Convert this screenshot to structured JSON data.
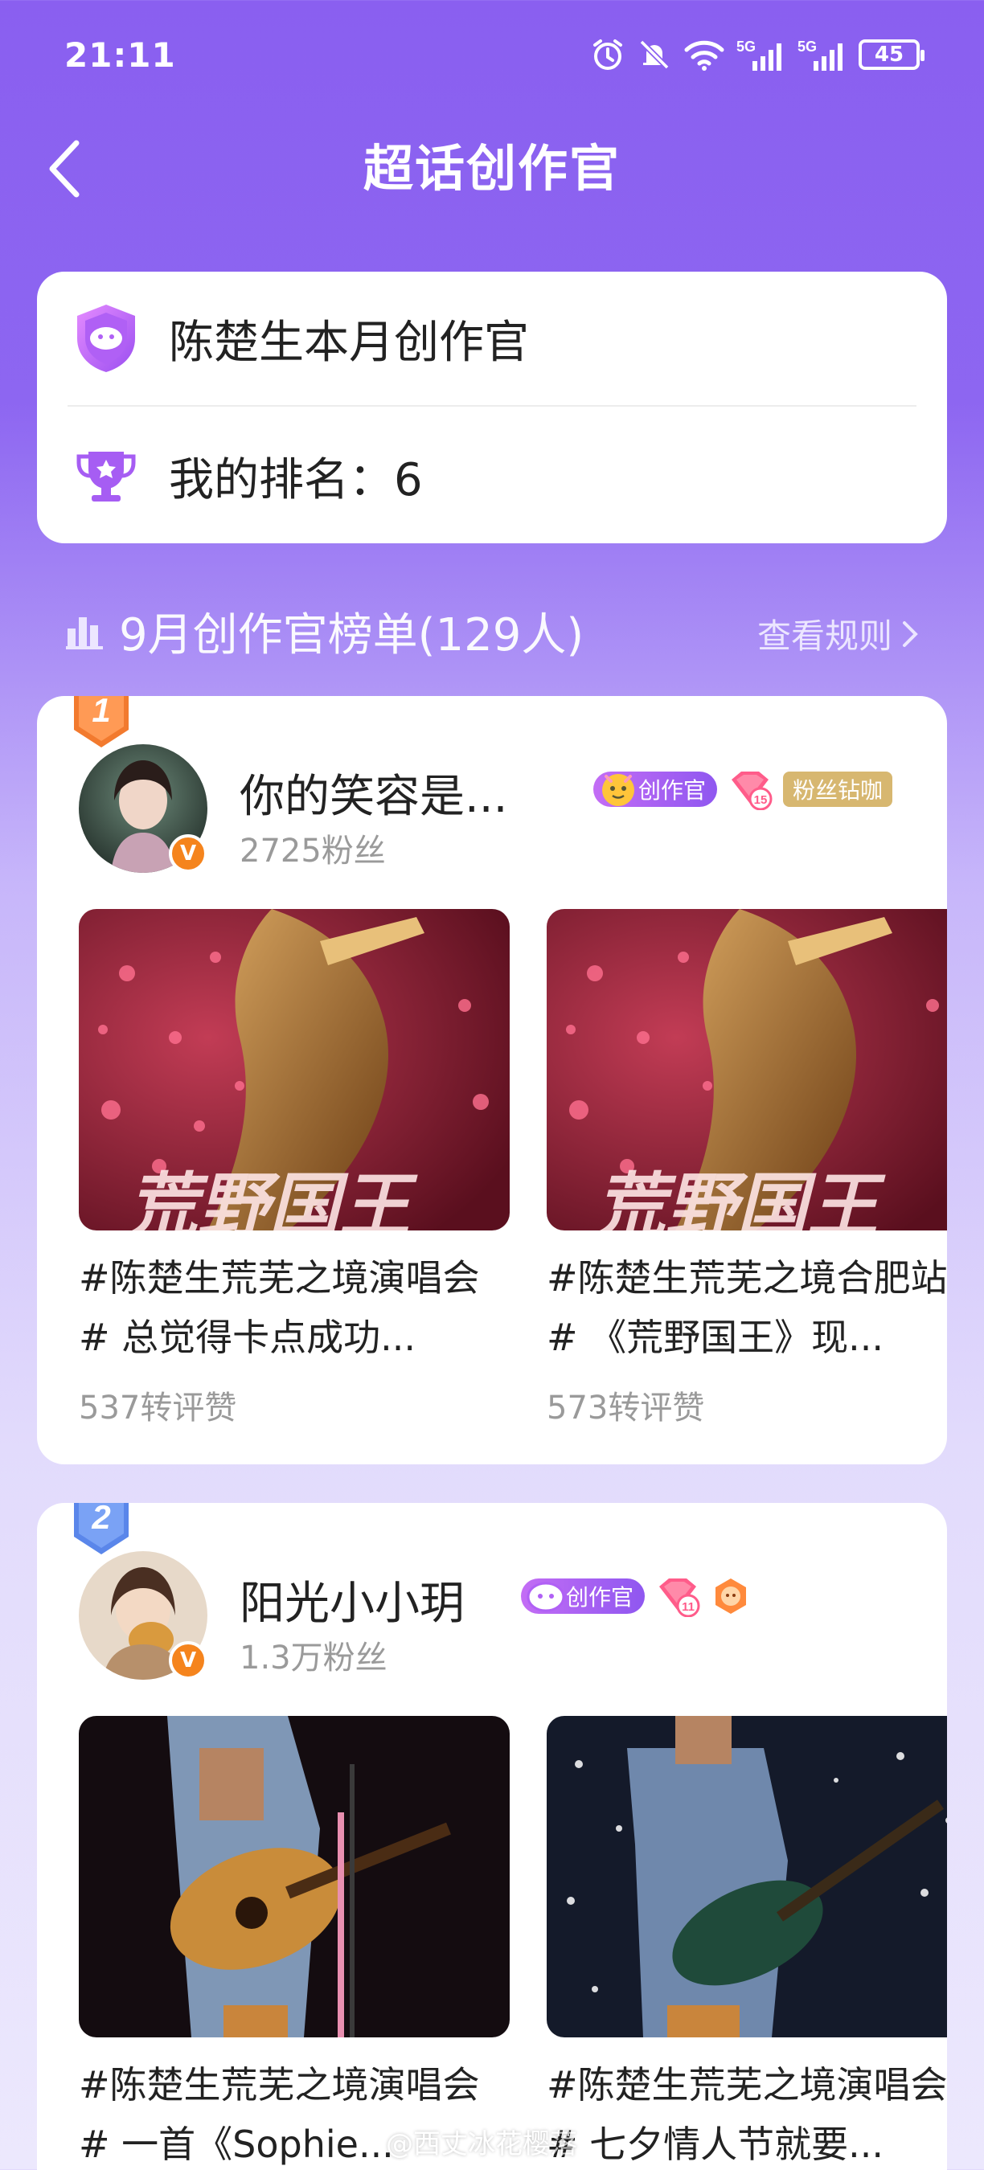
{
  "status_bar": {
    "time": "21:11",
    "network_1": "5G",
    "network_2": "5G",
    "battery": "45"
  },
  "header": {
    "title": "超话创作官",
    "back_icon": "chevron-left-icon"
  },
  "summary_card": {
    "creator_label": "陈楚生本月创作官",
    "rank_label": "我的排名：6"
  },
  "leaderboard": {
    "title": "9月创作官榜单(129人)",
    "rules_label": "查看规则"
  },
  "entries": [
    {
      "rank": "1",
      "name": "你的笑容是...",
      "fans": "2725粉丝",
      "creator_badge": "创作官",
      "level_badge": "15",
      "fan_badge": "粉丝钻咖",
      "posts": [
        {
          "text": "#陈楚生荒芜之境演唱会# 总觉得卡点成功...",
          "stat": "537转评赞",
          "thumb_caption": "荒野国王"
        },
        {
          "text": "#陈楚生荒芜之境合肥站# 《荒野国王》现...",
          "stat": "573转评赞",
          "thumb_caption": "荒野国王"
        }
      ]
    },
    {
      "rank": "2",
      "name": "阳光小小玥",
      "fans": "1.3万粉丝",
      "creator_badge": "创作官",
      "level_badge": "11",
      "posts": [
        {
          "text": "#陈楚生荒芜之境演唱会# 一首《Sophie...",
          "stat": ""
        },
        {
          "text": "#陈楚生荒芜之境演唱会# 七夕情人节就要...",
          "stat": ""
        }
      ]
    }
  ],
  "watermark": "@西丈冰花樱落",
  "colors": {
    "primary_purple": "#8a5ff0",
    "verified_orange": "#f5841d",
    "rank1_orange": "#f27a2e",
    "rank2_blue": "#5a86ea",
    "fan_badge_gold": "#d7b770"
  }
}
